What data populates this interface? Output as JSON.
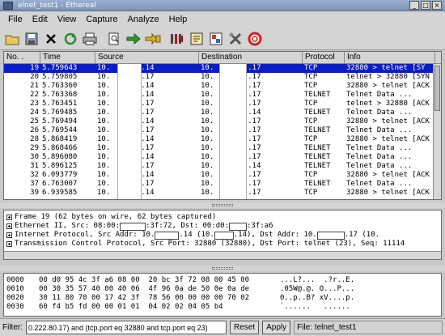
{
  "window": {
    "title": "elnet_test1 - Ethereal"
  },
  "menu": [
    "File",
    "Edit",
    "View",
    "Capture",
    "Analyze",
    "Help"
  ],
  "toolbar": [
    "open-icon",
    "save-icon",
    "close-icon",
    "reload-icon",
    "print-icon",
    "find-icon",
    "go-to-icon",
    "go-to-packet-icon",
    "capture-filter-icon",
    "display-filter-icon",
    "colorize-icon",
    "preferences-icon",
    "help-icon"
  ],
  "packet_list": {
    "columns": [
      "No. .",
      "Time",
      "Source",
      "Destination",
      "Protocol",
      "Info"
    ],
    "rows": [
      {
        "no": "19",
        "time": "5.759643",
        "src_a": "10.",
        "src_b": ".14",
        "dst_a": "10.",
        "dst_b": ".17",
        "proto": "TCP",
        "info": "32880 > telnet [SY",
        "selected": true
      },
      {
        "no": "20",
        "time": "5.759805",
        "src_a": "10.",
        "src_b": ".17",
        "dst_a": "10.",
        "dst_b": ".17",
        "proto": "TCP",
        "info": "telnet > 32880 [SYN"
      },
      {
        "no": "21",
        "time": "5.763360",
        "src_a": "10.",
        "src_b": ".14",
        "dst_a": "10.",
        "dst_b": ".17",
        "proto": "TCP",
        "info": "32880 > telnet [ACK"
      },
      {
        "no": "22",
        "time": "5.763368",
        "src_a": "10.",
        "src_b": ".14",
        "dst_a": "10.",
        "dst_b": ".17",
        "proto": "TELNET",
        "info": "Telnet Data ..."
      },
      {
        "no": "23",
        "time": "5.763451",
        "src_a": "10.",
        "src_b": ".17",
        "dst_a": "10.",
        "dst_b": ".17",
        "proto": "TCP",
        "info": "telnet > 32880 [ACK"
      },
      {
        "no": "24",
        "time": "5.769485",
        "src_a": "10.",
        "src_b": ".17",
        "dst_a": "10.",
        "dst_b": ".14",
        "proto": "TELNET",
        "info": "Telnet Data ..."
      },
      {
        "no": "25",
        "time": "5.769494",
        "src_a": "10.",
        "src_b": ".14",
        "dst_a": "10.",
        "dst_b": ".17",
        "proto": "TCP",
        "info": "32880 > telnet [ACK"
      },
      {
        "no": "26",
        "time": "5.769544",
        "src_a": "10.",
        "src_b": ".17",
        "dst_a": "10.",
        "dst_b": ".17",
        "proto": "TELNET",
        "info": "Telnet Data ..."
      },
      {
        "no": "28",
        "time": "5.868419",
        "src_a": "10.",
        "src_b": ".14",
        "dst_a": "10.",
        "dst_b": ".17",
        "proto": "TCP",
        "info": "32880 > telnet [ACK"
      },
      {
        "no": "29",
        "time": "5.868466",
        "src_a": "10.",
        "src_b": ".17",
        "dst_a": "10.",
        "dst_b": ".17",
        "proto": "TELNET",
        "info": "Telnet Data ..."
      },
      {
        "no": "30",
        "time": "5.896080",
        "src_a": "10.",
        "src_b": ".14",
        "dst_a": "10.",
        "dst_b": ".17",
        "proto": "TELNET",
        "info": "Telnet Data ..."
      },
      {
        "no": "31",
        "time": "5.896125",
        "src_a": "10.",
        "src_b": ".17",
        "dst_a": "10.",
        "dst_b": ".14",
        "proto": "TELNET",
        "info": "Telnet Data ..."
      },
      {
        "no": "32",
        "time": "6.093779",
        "src_a": "10.",
        "src_b": ".14",
        "dst_a": "10.",
        "dst_b": ".17",
        "proto": "TCP",
        "info": "32880 > telnet [ACK"
      },
      {
        "no": "37",
        "time": "6.763007",
        "src_a": "10.",
        "src_b": ".17",
        "dst_a": "10.",
        "dst_b": ".17",
        "proto": "TELNET",
        "info": "Telnet Data ..."
      },
      {
        "no": "39",
        "time": "6.939585",
        "src_a": "10.",
        "src_b": ".14",
        "dst_a": "10.",
        "dst_b": ".17",
        "proto": "TCP",
        "info": "32880 > telnet [ACK"
      }
    ]
  },
  "detail": {
    "frame": "Frame 19 (62 bytes on wire, 62 bytes captured)",
    "ethernet_a": "Ethernet II, Src: 08:00:",
    "ethernet_b": ":3f:72, Dst: 00:d0:",
    "ethernet_c": ":3f:a6",
    "ip_a": "Internet Protocol, Src Addr: 10.",
    "ip_b": ".14 (10.",
    "ip_c": ".14), Dst Addr: 10.",
    "ip_d": ".17 (10.",
    "tcp": "Transmission Control Protocol, Src Port: 32880 (32880), Dst Port: telnet (23), Seq: 11114"
  },
  "hex": [
    {
      "offset": "0000",
      "bytes": "00 d0 95 4c 3f a6 08 00  20 bc 3f 72 08 00 45 00",
      "ascii": "...L?...  .?r..E."
    },
    {
      "offset": "0010",
      "bytes": "00 30 35 57 40 00 40 06  4f 96 0a de 50 0e 0a de",
      "ascii": ".05W@.@. O...P..."
    },
    {
      "offset": "0020",
      "bytes": "30 11 80 70 00 17 42 3f  78 56 00 00 00 00 70 02",
      "ascii": "0..p..B? xV....p."
    },
    {
      "offset": "0030",
      "bytes": "60 f4 b5 fd 00 00 01 01  04 02 02 04 05 b4",
      "ascii": "`......   ......"
    }
  ],
  "statusbar": {
    "filter_label": "Filter:",
    "filter_value": "0.222.80.17) and (tcp.port eq 32880 and tcp.port eq 23)",
    "reset_label": "Reset",
    "apply_label": "Apply",
    "file_label": "File: telnet_test1"
  }
}
